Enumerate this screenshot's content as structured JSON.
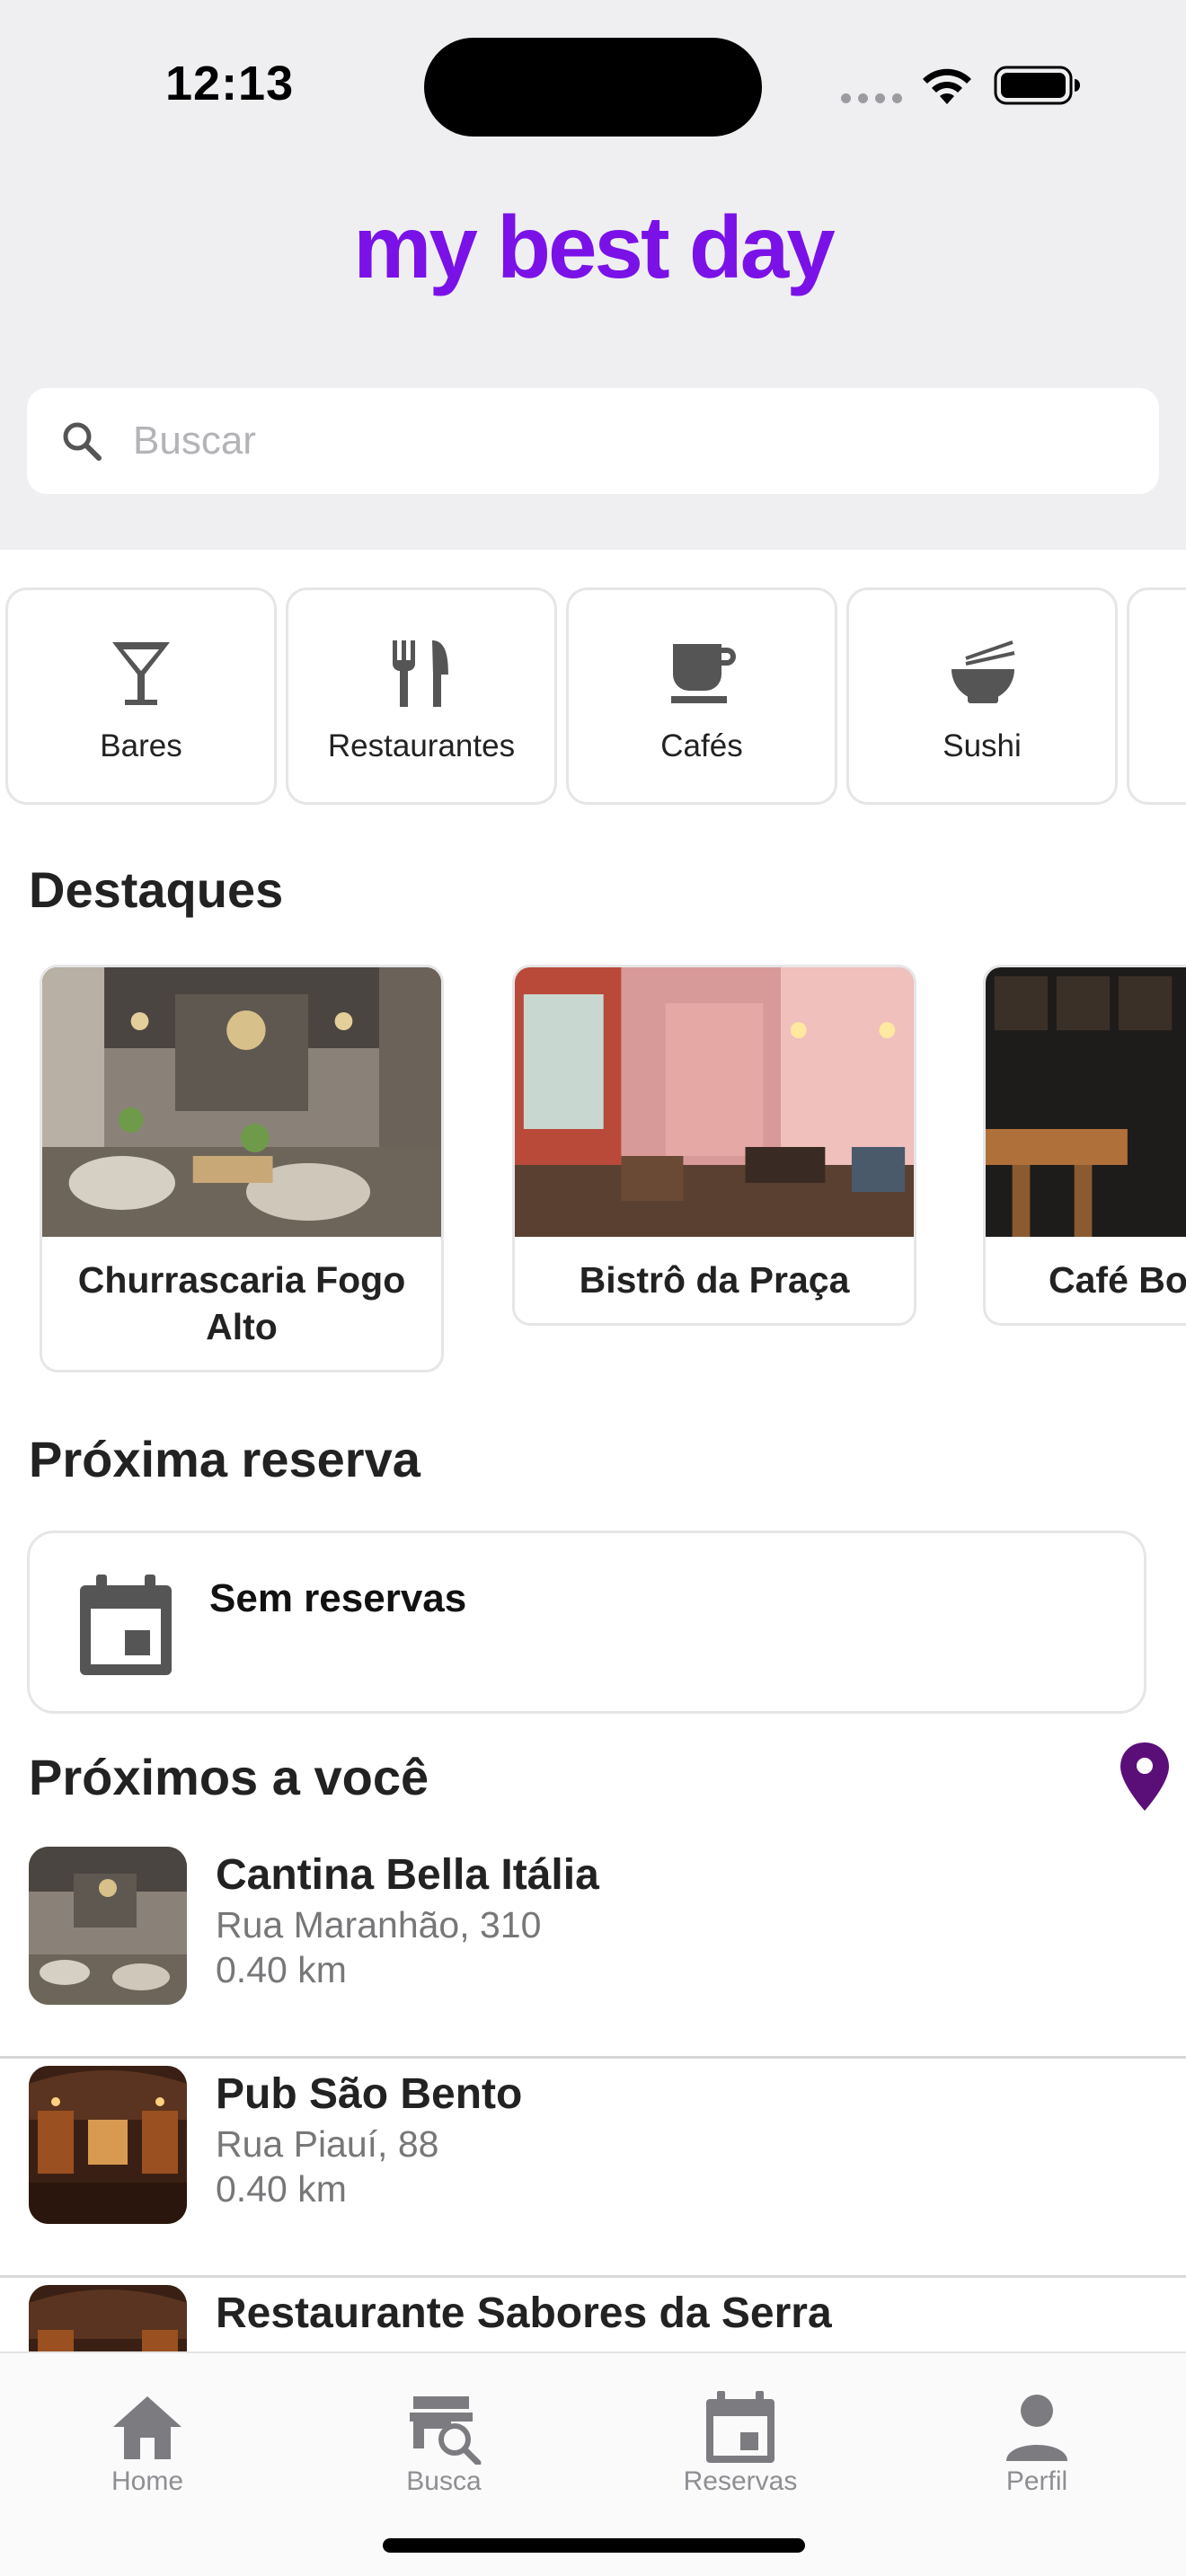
{
  "status_bar": {
    "time": "12:13"
  },
  "app": {
    "logo_text": "my best day",
    "brand_color": "#7a12e8"
  },
  "search": {
    "placeholder": "Buscar",
    "value": ""
  },
  "categories": [
    {
      "label": "Bares",
      "icon": "cocktail-glass-icon"
    },
    {
      "label": "Restaurantes",
      "icon": "fork-knife-icon"
    },
    {
      "label": "Cafés",
      "icon": "coffee-cup-icon"
    },
    {
      "label": "Sushi",
      "icon": "noodle-bowl-icon"
    }
  ],
  "highlights": {
    "title": "Destaques",
    "items": [
      {
        "name": "Churrascaria Fogo Alto"
      },
      {
        "name": "Bistrô da Praça"
      },
      {
        "name": "Café Bo"
      }
    ]
  },
  "next_reservation": {
    "title": "Próxima reserva",
    "empty_text": "Sem reservas",
    "icon": "calendar-icon"
  },
  "nearby": {
    "title": "Próximos a você",
    "pin_color": "#5a0f78",
    "items": [
      {
        "name": "Cantina Bella Itália",
        "address": "Rua Maranhão, 310",
        "distance": "0.40 km"
      },
      {
        "name": "Pub São Bento",
        "address": "Rua Piauí, 88",
        "distance": "0.40 km"
      },
      {
        "name": "Restaurante Sabores da Serra",
        "address": "",
        "distance": ""
      }
    ]
  },
  "tab_bar": {
    "tabs": [
      {
        "label": "Home",
        "icon": "home-icon",
        "active": true
      },
      {
        "label": "Busca",
        "icon": "map-search-icon",
        "active": false
      },
      {
        "label": "Reservas",
        "icon": "calendar-icon",
        "active": false
      },
      {
        "label": "Perfil",
        "icon": "person-icon",
        "active": false
      }
    ]
  }
}
